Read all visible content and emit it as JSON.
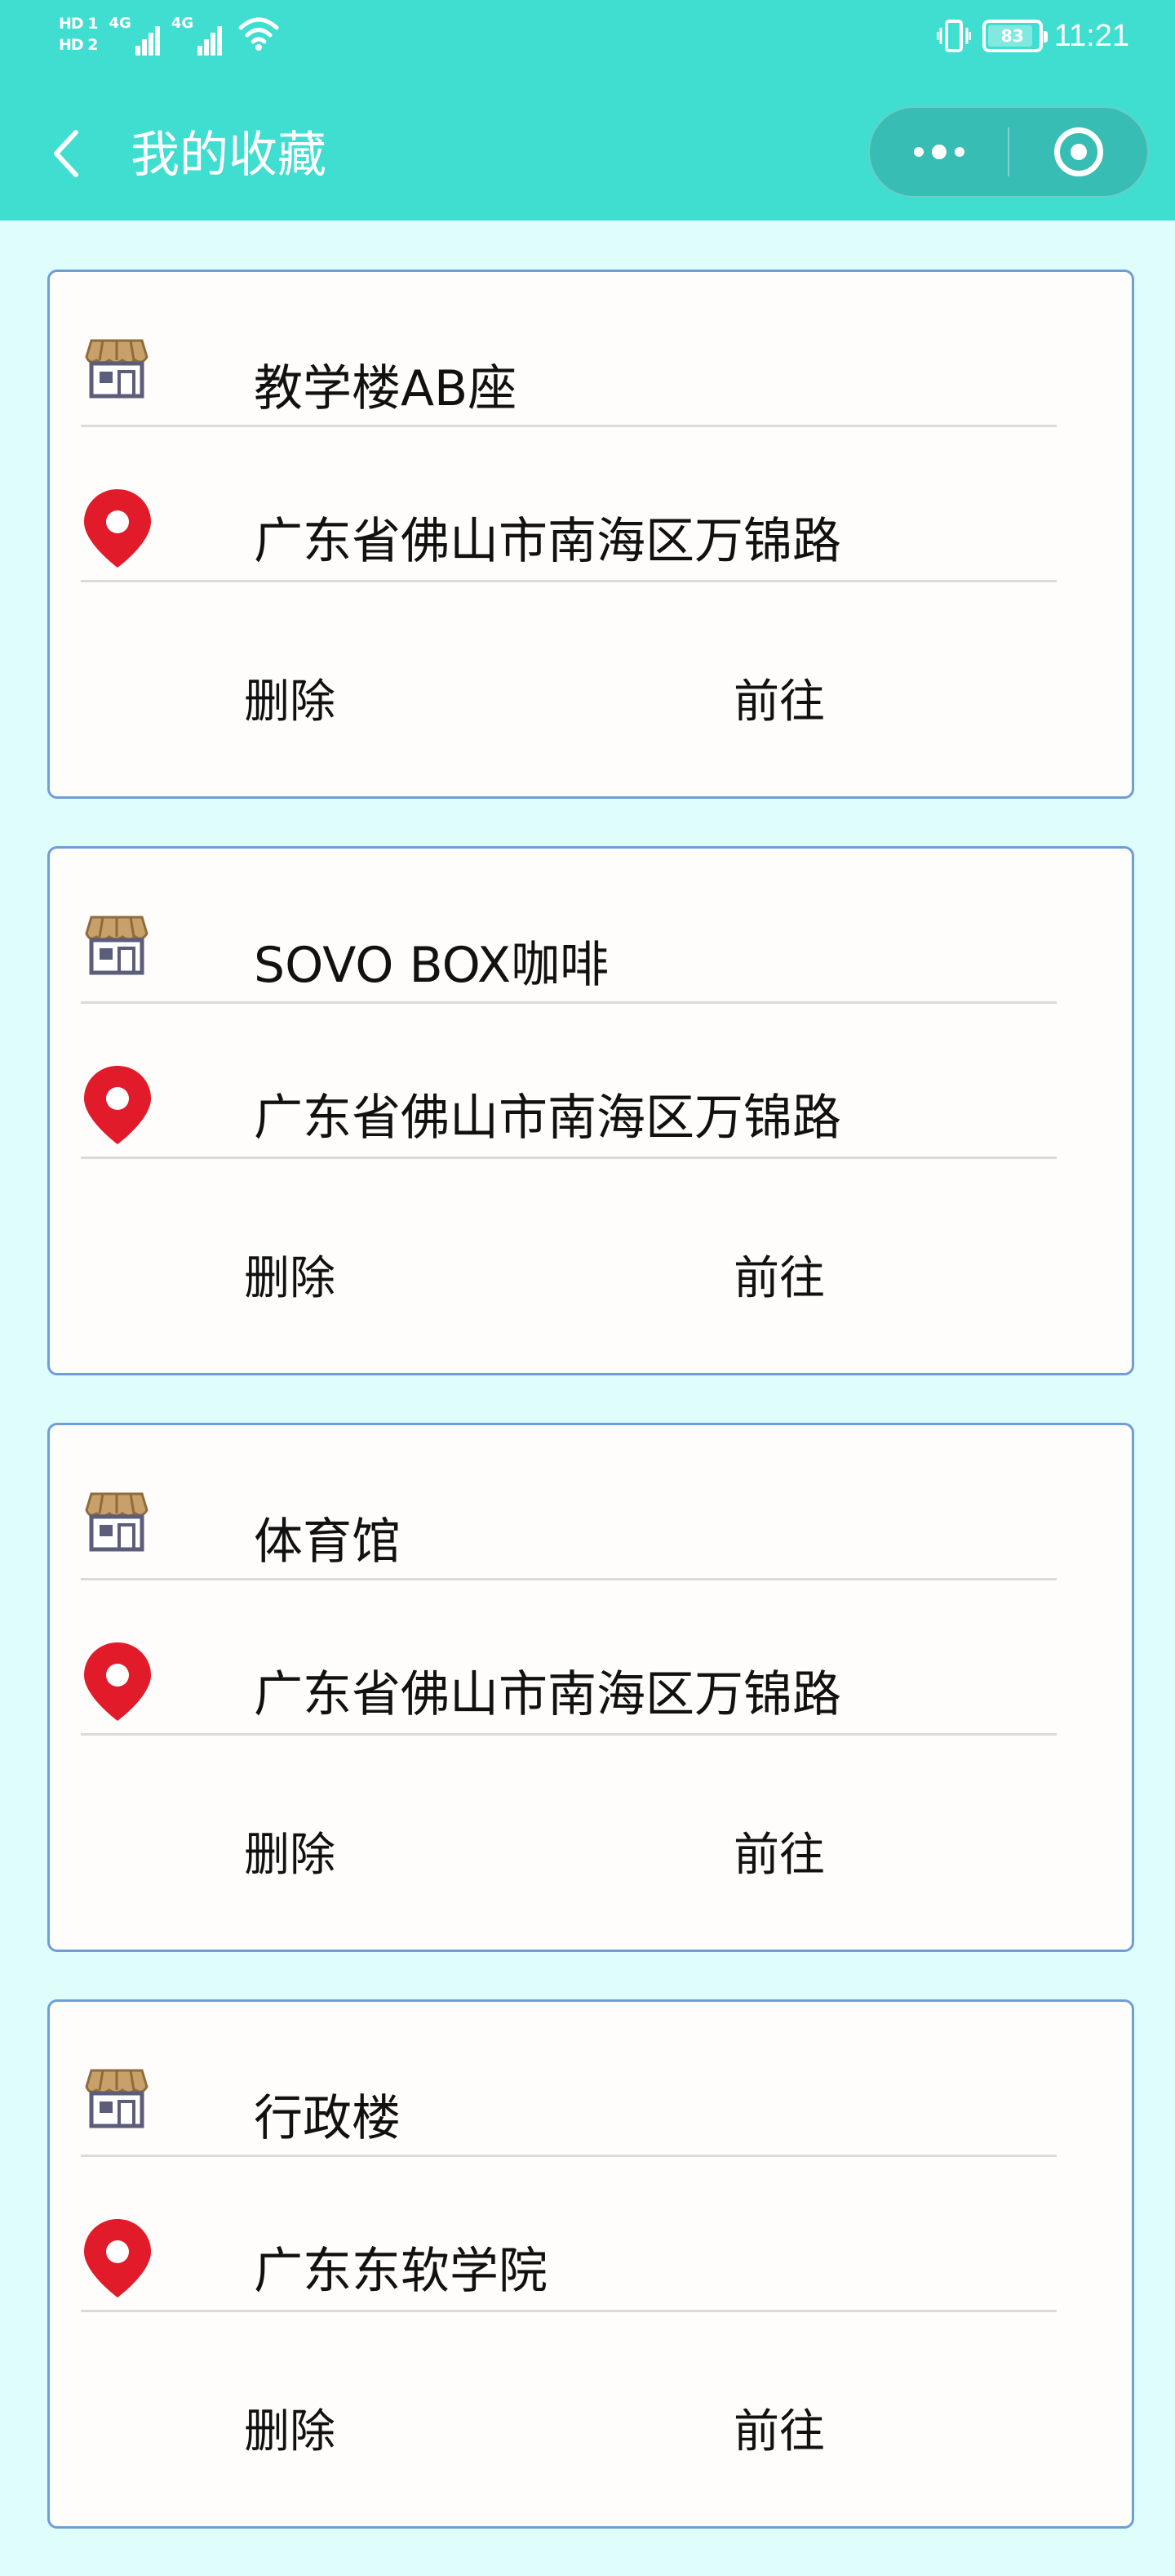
{
  "status_bar": {
    "sim1": "HD 1",
    "sim2": "HD 2",
    "net1": "4G",
    "net2": "4G",
    "battery": "83",
    "time": "11:21"
  },
  "nav": {
    "title": "我的收藏",
    "back_icon": "chevron-left-icon",
    "more_icon": "more-dots-icon",
    "close_icon": "target-close-icon"
  },
  "colors": {
    "header": "#40ddd1",
    "page_bg": "#dffdfb",
    "card_border": "#6e9ed8",
    "pin_red": "#e21b2a"
  },
  "favorites": [
    {
      "name": "教学楼AB座",
      "address": "广东省佛山市南海区万锦路",
      "delete_label": "删除",
      "go_label": "前往"
    },
    {
      "name": "SOVO BOX咖啡",
      "address": "广东省佛山市南海区万锦路",
      "delete_label": "删除",
      "go_label": "前往"
    },
    {
      "name": "体育馆",
      "address": "广东省佛山市南海区万锦路",
      "delete_label": "删除",
      "go_label": "前往"
    },
    {
      "name": "行政楼",
      "address": "广东东软学院",
      "delete_label": "删除",
      "go_label": "前往"
    }
  ]
}
